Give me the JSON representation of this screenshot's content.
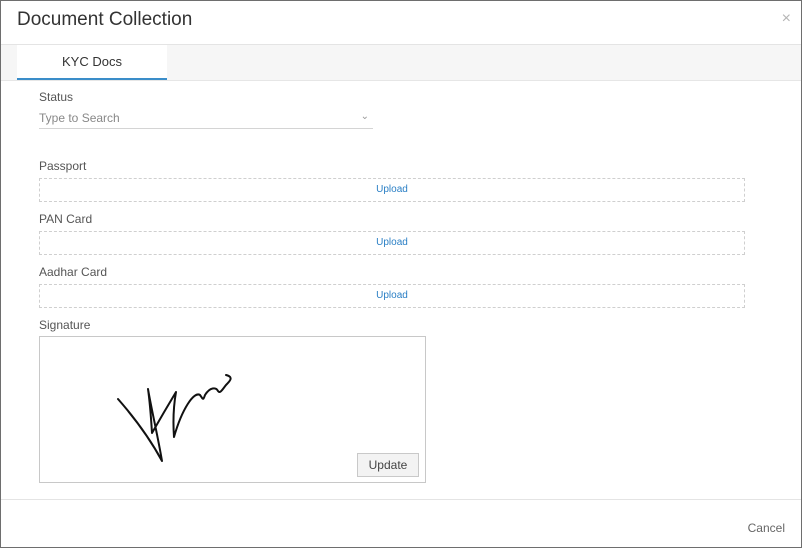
{
  "dialog": {
    "title": "Document Collection",
    "close_icon": "×"
  },
  "tabs": [
    {
      "label": "KYC Docs",
      "active": true
    }
  ],
  "form": {
    "status": {
      "label": "Status",
      "placeholder": "Type to Search",
      "chevron_icon": "⌄"
    },
    "passport": {
      "label": "Passport",
      "upload_label": "Upload"
    },
    "pan_card": {
      "label": "PAN Card",
      "upload_label": "Upload"
    },
    "aadhar_card": {
      "label": "Aadhar Card",
      "upload_label": "Upload"
    },
    "signature": {
      "label": "Signature",
      "update_label": "Update"
    }
  },
  "footer": {
    "cancel_label": "Cancel"
  },
  "colors": {
    "accent": "#3a8dc9",
    "link": "#2a7fc5"
  }
}
